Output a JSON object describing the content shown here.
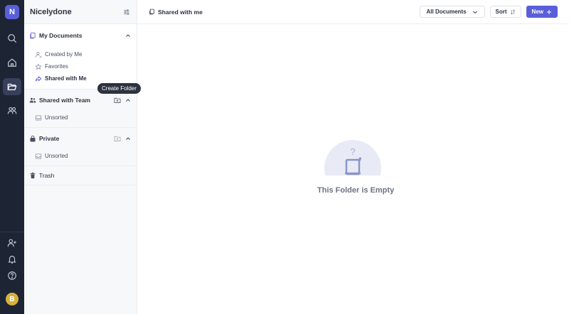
{
  "rail": {
    "logo_letter": "N",
    "avatar_letter": "B",
    "accent_color": "#5a5fd9",
    "avatar_color": "#d6b13a"
  },
  "sidebar": {
    "title": "Nicelydone",
    "sections": {
      "my_documents": {
        "label": "My Documents",
        "items": [
          {
            "label": "Created by Me",
            "icon": "user-icon"
          },
          {
            "label": "Favorites",
            "icon": "star-icon"
          },
          {
            "label": "Shared with Me",
            "icon": "share-icon",
            "active": true
          }
        ]
      },
      "shared_with_team": {
        "label": "Shared with Team",
        "items": [
          {
            "label": "Unsorted",
            "icon": "inbox-icon"
          }
        ]
      },
      "private": {
        "label": "Private",
        "items": [
          {
            "label": "Unsorted",
            "icon": "inbox-icon"
          }
        ]
      },
      "trash": {
        "label": "Trash"
      }
    },
    "tooltip": "Create Folder"
  },
  "topbar": {
    "breadcrumb": "Shared with me",
    "filter_label": "All Documents",
    "sort_label": "Sort",
    "new_label": "New"
  },
  "empty_state": {
    "mark": "?",
    "message": "This Folder is Empty"
  }
}
